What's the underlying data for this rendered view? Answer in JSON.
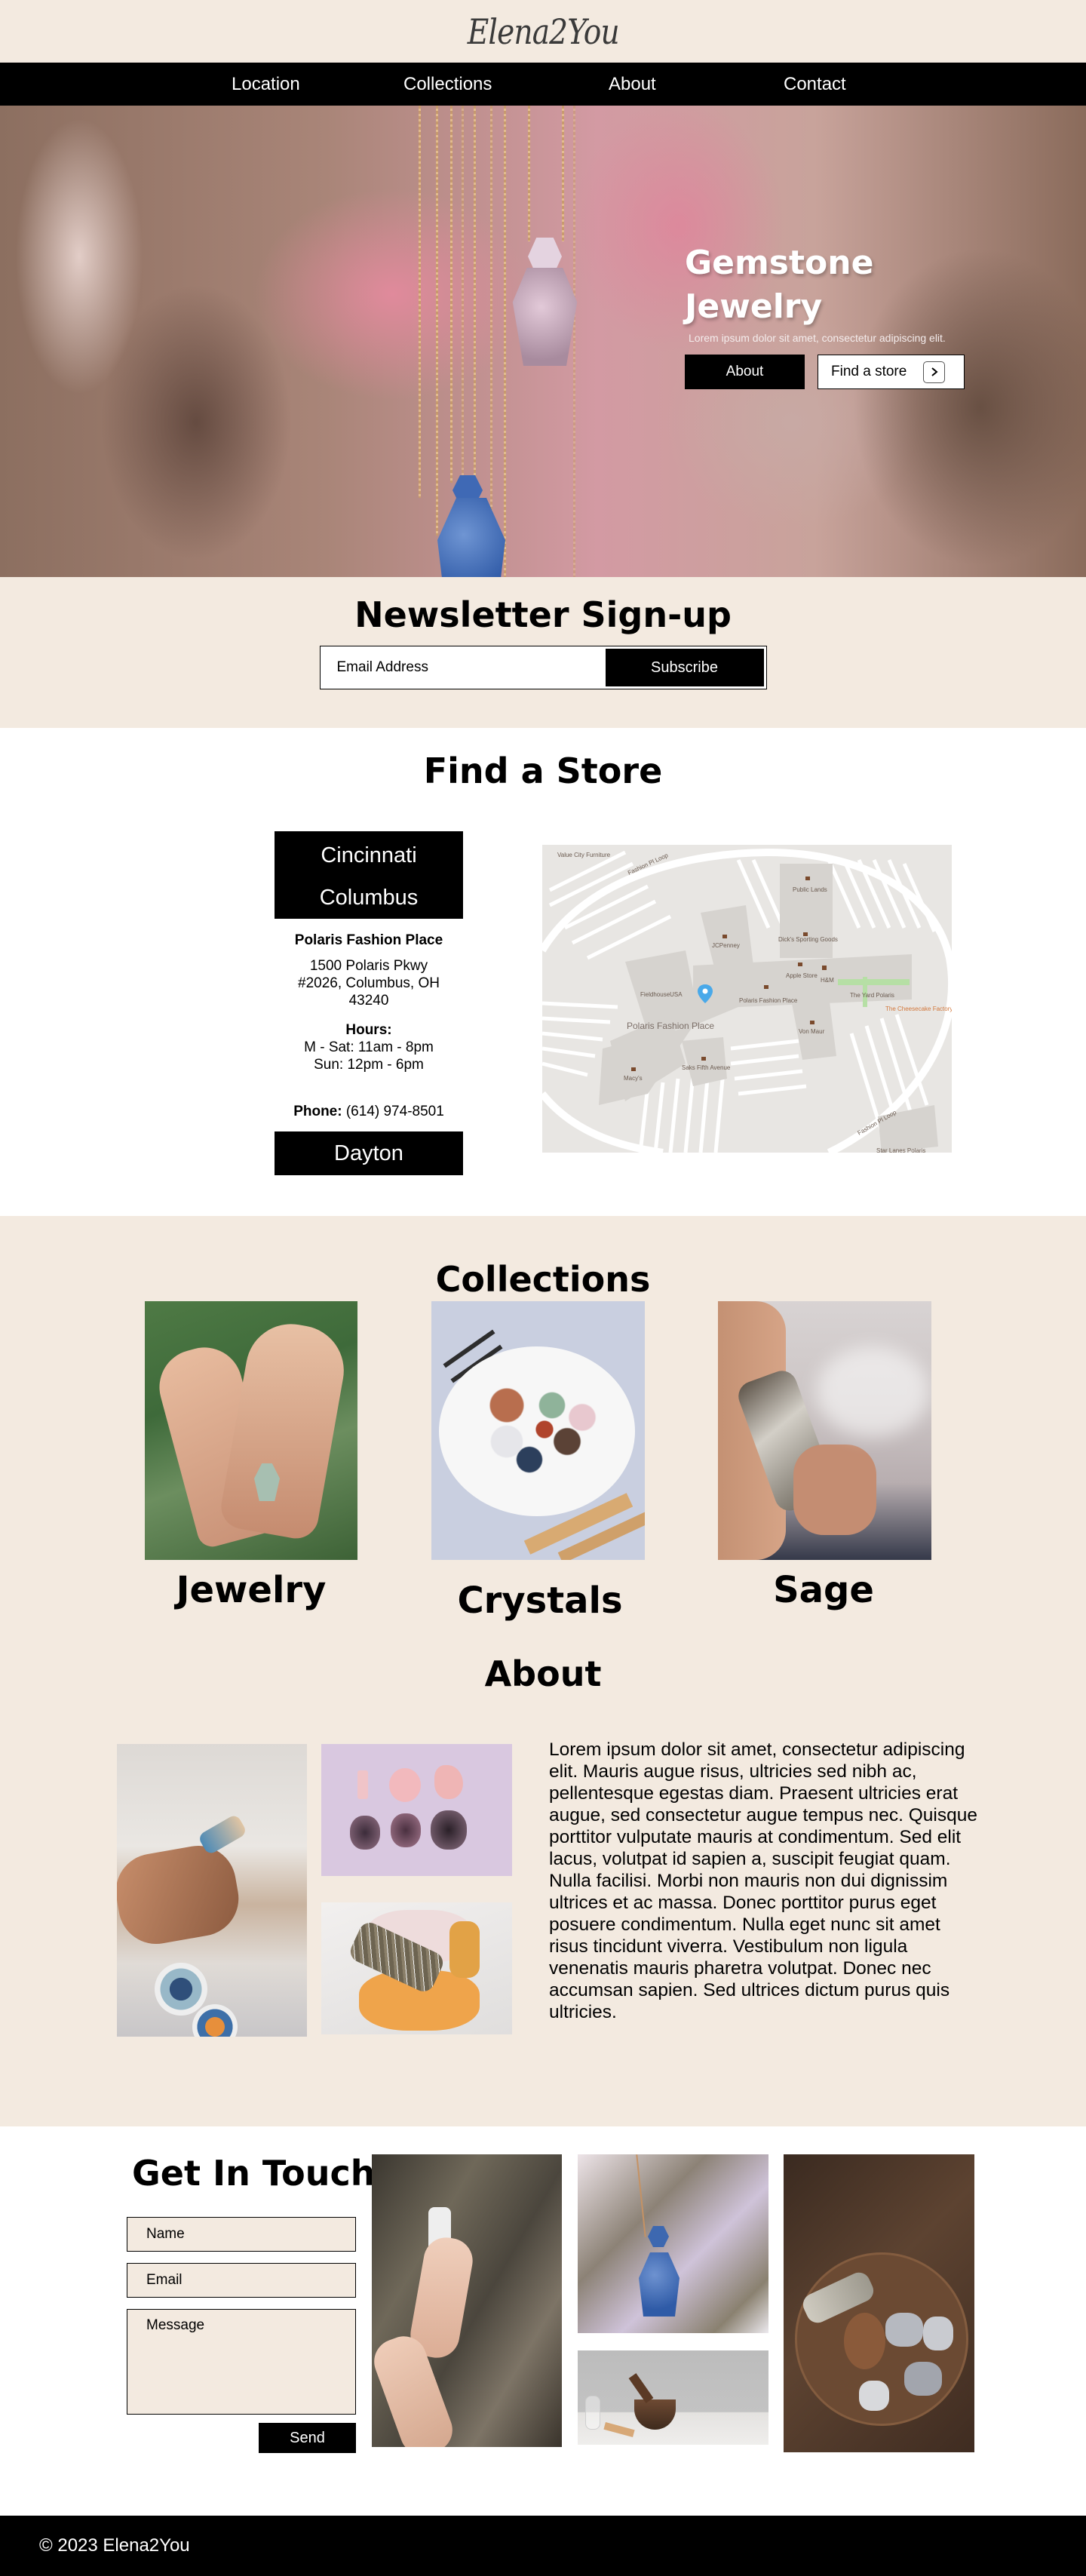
{
  "brand": {
    "logo": "Elena2You",
    "colors": {
      "cream": "#f3eae0",
      "black": "#000000",
      "white": "#ffffff"
    }
  },
  "nav": {
    "items": [
      {
        "label": "Location"
      },
      {
        "label": "Collections"
      },
      {
        "label": "About"
      },
      {
        "label": "Contact"
      }
    ]
  },
  "hero": {
    "title_line1": "Gemstone",
    "title_line2": "Jewelry",
    "subtitle": "Lorem ipsum dolor sit amet, consectetur adipiscing elit.",
    "about_button": "About",
    "find_store_button": "Find a store",
    "find_store_icon": "chevron-right-icon",
    "image_alt": "Gemstone perfume bottle pendants hanging on gold chains"
  },
  "newsletter": {
    "title": "Newsletter Sign-up",
    "email_placeholder": "Email Address",
    "subscribe_button": "Subscribe"
  },
  "store": {
    "title": "Find a Store",
    "cities": [
      "Cincinnati",
      "Columbus",
      "Dayton"
    ],
    "selected_city": "Columbus",
    "location_name": "Polaris Fashion Place",
    "address_line1": "1500 Polaris Pkwy",
    "address_line2": "#2026, Columbus, OH",
    "address_line3": "43240",
    "hours_label": "Hours:",
    "hours_weekday": "M - Sat: 11am - 8pm",
    "hours_sunday": "Sun: 12pm - 6pm",
    "phone_label": "Phone:",
    "phone": "(614) 974-8501",
    "map": {
      "main_label": "Polaris Fashion Place",
      "roads": [
        "Fashion Pl Loop",
        "Fashion Pl Loop",
        "Pl Loop",
        "Loop"
      ],
      "places": [
        "Value City Furniture",
        "Public Lands",
        "JCPenney",
        "Dick's Sporting Goods",
        "FieldhouseUSA",
        "Apple Store",
        "H&M",
        "Polaris Fashion Place",
        "The Yard Polaris",
        "The Cheesecake Factory",
        "Von Maur",
        "Saks Fifth Avenue",
        "Macy's",
        "Star Lanes Polaris"
      ]
    }
  },
  "collections": {
    "title": "Collections",
    "items": [
      {
        "label": "Jewelry",
        "image_alt": "Hands wearing a gemstone ring and bracelet chain"
      },
      {
        "label": "Crystals",
        "image_alt": "Plate of assorted tumbled crystals with incense and palo santo"
      },
      {
        "label": "Sage",
        "image_alt": "Hand holding a smoking sage bundle"
      }
    ]
  },
  "about": {
    "title": "About",
    "body": "Lorem ipsum dolor sit amet, consectetur adipiscing elit. Mauris augue risus, ultricies sed nibh ac, pellentesque egestas diam. Praesent ultricies erat augue, sed consectetur augue tempus nec. Quisque porttitor vulputate mauris at condimentum. Sed elit lacus, volutpat id sapien a, suscipit feugiat quam. Nulla facilisi. Morbi non mauris non dui dignissim ultrices et ac massa. Donec porttitor purus eget posuere condimentum. Nulla eget nunc sit amet risus tincidunt viverra. Vestibulum non ligula venenatis mauris pharetra volutpat. Donec nec accumsan sapien. Sed ultrices dictum purus quis ultricies.",
    "images": [
      {
        "alt": "Person lighting a sage bundle over tarot cards"
      },
      {
        "alt": "Rose quartz and amethyst geodes on lavender background"
      },
      {
        "alt": "Sage bundle with crystals on marble"
      }
    ]
  },
  "contact": {
    "title": "Get In Touch",
    "name_placeholder": "Name",
    "email_placeholder": "Email",
    "message_placeholder": "Message",
    "send_button": "Send",
    "images": [
      {
        "alt": "Hands holding a clear quartz crystal"
      },
      {
        "alt": "Lapis lazuli pendant on dried lavender"
      },
      {
        "alt": "Singing bowl with palo santo and crystals"
      },
      {
        "alt": "Wooden tray with sage and crystal clusters"
      }
    ]
  },
  "footer": {
    "copyright": "© 2023 Elena2You"
  }
}
